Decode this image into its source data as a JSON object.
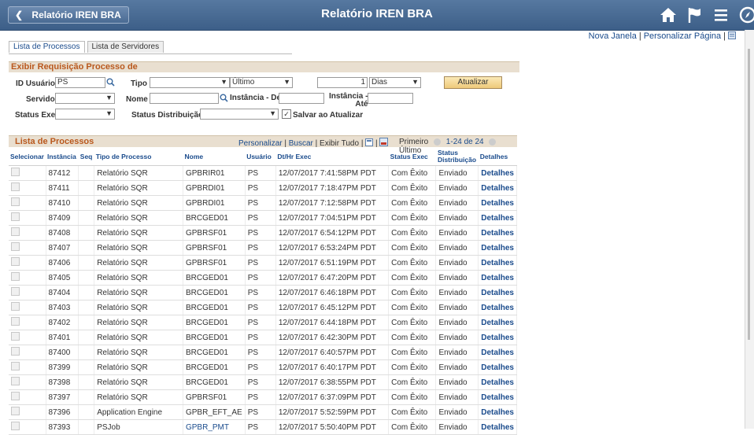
{
  "header": {
    "back_label": "Relatório IREN BRA",
    "title": "Relatório IREN BRA"
  },
  "top_links": {
    "new_window": "Nova Janela",
    "personalize_page": "Personalizar Página"
  },
  "tabs": [
    {
      "label": "Lista de Processos"
    },
    {
      "label": "Lista de Servidores"
    }
  ],
  "form": {
    "section_title": "Exibir Requisição Processo de",
    "user_id_label": "ID Usuário",
    "user_id_value": "PS",
    "type_label": "Tipo",
    "type_value": "",
    "last_value": "Último",
    "count_value": "1",
    "unit_value": "Dias",
    "refresh_label": "Atualizar",
    "server_label": "Servidor",
    "server_value": "",
    "name_label": "Nome",
    "name_value": "",
    "instance_from_label": "Instância - De",
    "instance_from_value": "",
    "instance_to_label": "Instância -",
    "instance_to_label2": "Até",
    "instance_to_value": "",
    "run_status_label": "Status Exec",
    "run_status_value": "",
    "dist_status_label": "Status Distribuição",
    "dist_status_value": "",
    "save_on_refresh_label": "Salvar ao Atualizar",
    "save_on_refresh_checked": true
  },
  "grid": {
    "title": "Lista de Processos",
    "personalize": "Personalizar",
    "find": "Buscar",
    "view_all": "Exibir Tudo",
    "first": "Primeiro",
    "range": "1-24 de 24",
    "last": "Último",
    "columns": [
      "Selecionar",
      "Instância",
      "Seq",
      "Tipo de Processo",
      "Nome",
      "Usuário",
      "Dt/Hr Exec",
      "Status Exec",
      "Status Distribuição",
      "Detalhes"
    ],
    "rows": [
      {
        "instance": "87412",
        "seq": "",
        "type": "Relatório SQR",
        "name": "GPBRIR01",
        "user": "PS",
        "datetime": "12/07/2017  7:41:58PM PDT",
        "run_status": "Com Êxito",
        "dist_status": "Enviado",
        "details": "Detalhes"
      },
      {
        "instance": "87411",
        "seq": "",
        "type": "Relatório SQR",
        "name": "GPBRDI01",
        "user": "PS",
        "datetime": "12/07/2017  7:18:47PM PDT",
        "run_status": "Com Êxito",
        "dist_status": "Enviado",
        "details": "Detalhes"
      },
      {
        "instance": "87410",
        "seq": "",
        "type": "Relatório SQR",
        "name": "GPBRDI01",
        "user": "PS",
        "datetime": "12/07/2017  7:12:58PM PDT",
        "run_status": "Com Êxito",
        "dist_status": "Enviado",
        "details": "Detalhes"
      },
      {
        "instance": "87409",
        "seq": "",
        "type": "Relatório SQR",
        "name": "BRCGED01",
        "user": "PS",
        "datetime": "12/07/2017  7:04:51PM PDT",
        "run_status": "Com Êxito",
        "dist_status": "Enviado",
        "details": "Detalhes"
      },
      {
        "instance": "87408",
        "seq": "",
        "type": "Relatório SQR",
        "name": "GPBRSF01",
        "user": "PS",
        "datetime": "12/07/2017  6:54:12PM PDT",
        "run_status": "Com Êxito",
        "dist_status": "Enviado",
        "details": "Detalhes"
      },
      {
        "instance": "87407",
        "seq": "",
        "type": "Relatório SQR",
        "name": "GPBRSF01",
        "user": "PS",
        "datetime": "12/07/2017  6:53:24PM PDT",
        "run_status": "Com Êxito",
        "dist_status": "Enviado",
        "details": "Detalhes"
      },
      {
        "instance": "87406",
        "seq": "",
        "type": "Relatório SQR",
        "name": "GPBRSF01",
        "user": "PS",
        "datetime": "12/07/2017  6:51:19PM PDT",
        "run_status": "Com Êxito",
        "dist_status": "Enviado",
        "details": "Detalhes"
      },
      {
        "instance": "87405",
        "seq": "",
        "type": "Relatório SQR",
        "name": "BRCGED01",
        "user": "PS",
        "datetime": "12/07/2017  6:47:20PM PDT",
        "run_status": "Com Êxito",
        "dist_status": "Enviado",
        "details": "Detalhes"
      },
      {
        "instance": "87404",
        "seq": "",
        "type": "Relatório SQR",
        "name": "BRCGED01",
        "user": "PS",
        "datetime": "12/07/2017  6:46:18PM PDT",
        "run_status": "Com Êxito",
        "dist_status": "Enviado",
        "details": "Detalhes"
      },
      {
        "instance": "87403",
        "seq": "",
        "type": "Relatório SQR",
        "name": "BRCGED01",
        "user": "PS",
        "datetime": "12/07/2017  6:45:12PM PDT",
        "run_status": "Com Êxito",
        "dist_status": "Enviado",
        "details": "Detalhes"
      },
      {
        "instance": "87402",
        "seq": "",
        "type": "Relatório SQR",
        "name": "BRCGED01",
        "user": "PS",
        "datetime": "12/07/2017  6:44:18PM PDT",
        "run_status": "Com Êxito",
        "dist_status": "Enviado",
        "details": "Detalhes"
      },
      {
        "instance": "87401",
        "seq": "",
        "type": "Relatório SQR",
        "name": "BRCGED01",
        "user": "PS",
        "datetime": "12/07/2017  6:42:30PM PDT",
        "run_status": "Com Êxito",
        "dist_status": "Enviado",
        "details": "Detalhes"
      },
      {
        "instance": "87400",
        "seq": "",
        "type": "Relatório SQR",
        "name": "BRCGED01",
        "user": "PS",
        "datetime": "12/07/2017  6:40:57PM PDT",
        "run_status": "Com Êxito",
        "dist_status": "Enviado",
        "details": "Detalhes"
      },
      {
        "instance": "87399",
        "seq": "",
        "type": "Relatório SQR",
        "name": "BRCGED01",
        "user": "PS",
        "datetime": "12/07/2017  6:40:17PM PDT",
        "run_status": "Com Êxito",
        "dist_status": "Enviado",
        "details": "Detalhes"
      },
      {
        "instance": "87398",
        "seq": "",
        "type": "Relatório SQR",
        "name": "BRCGED01",
        "user": "PS",
        "datetime": "12/07/2017  6:38:55PM PDT",
        "run_status": "Com Êxito",
        "dist_status": "Enviado",
        "details": "Detalhes"
      },
      {
        "instance": "87397",
        "seq": "",
        "type": "Relatório SQR",
        "name": "GPBRSF01",
        "user": "PS",
        "datetime": "12/07/2017  6:37:09PM PDT",
        "run_status": "Com Êxito",
        "dist_status": "Enviado",
        "details": "Detalhes"
      },
      {
        "instance": "87396",
        "seq": "",
        "type": "Application Engine",
        "name": "GPBR_EFT_AE",
        "user": "PS",
        "datetime": "12/07/2017  5:52:59PM PDT",
        "run_status": "Com Êxito",
        "dist_status": "Enviado",
        "details": "Detalhes"
      },
      {
        "instance": "87393",
        "seq": "",
        "type": "PSJob",
        "name": "GPBR_PMT",
        "user": "PS",
        "datetime": "12/07/2017  5:50:40PM PDT",
        "run_status": "Com Êxito",
        "dist_status": "Enviado",
        "details": "Detalhes",
        "name_is_link": true
      }
    ]
  }
}
